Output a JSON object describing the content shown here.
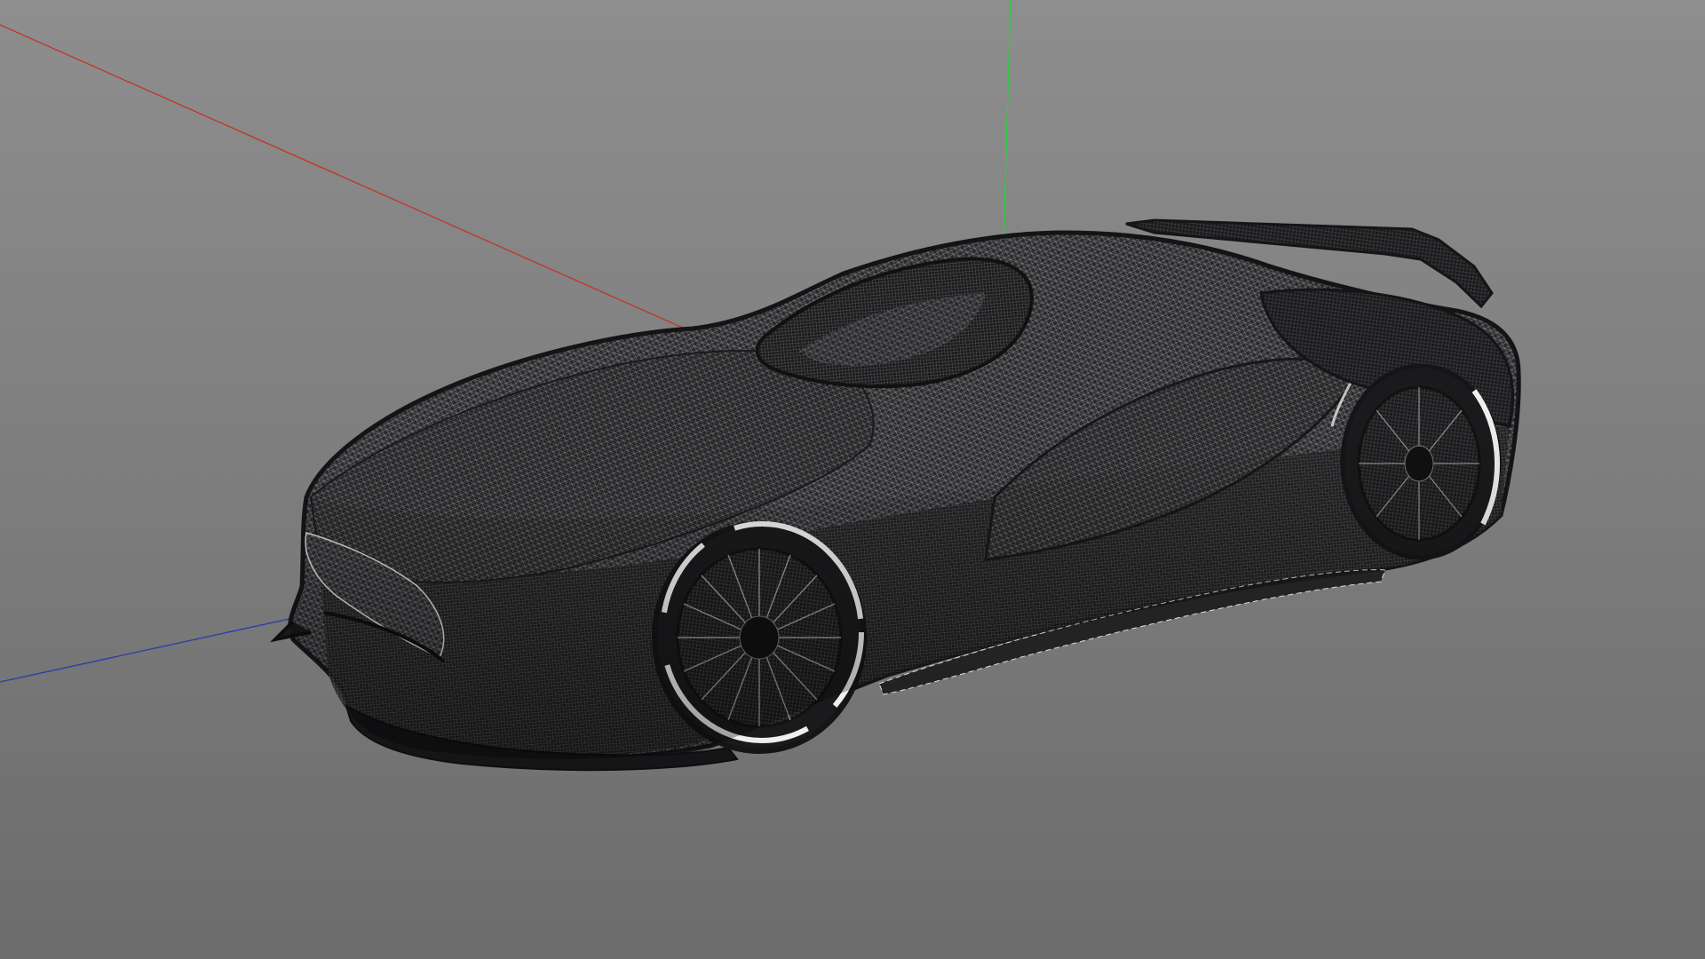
{
  "viewport": {
    "background_top": "#8e8e8e",
    "background_bottom": "#6c6c6c"
  },
  "axes": {
    "x_color": "#c0392b",
    "y_color": "#2ecc40",
    "z_color": "#2d3fa6"
  },
  "model": {
    "kind": "wireframe-sports-car",
    "wire_color": "#1c1c1e",
    "highlight_color": "#e8e8e8"
  }
}
